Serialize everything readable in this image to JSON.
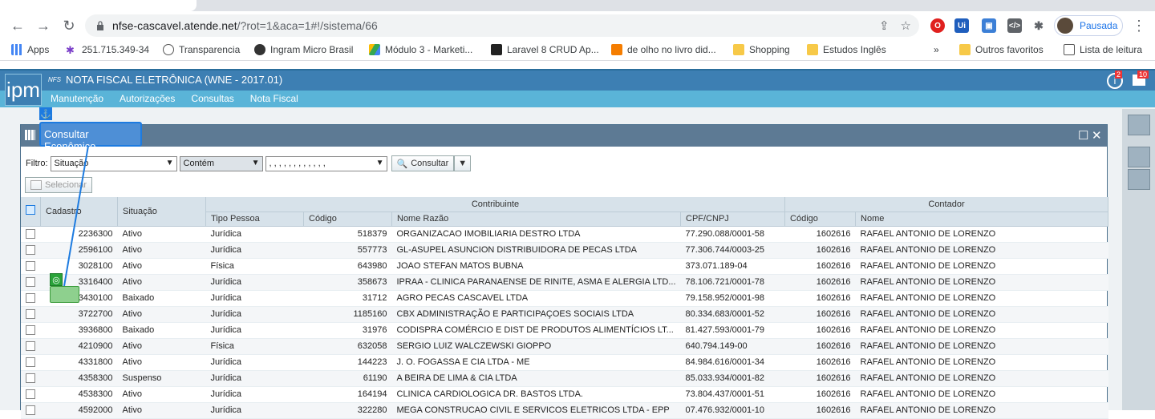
{
  "browser": {
    "url_host": "nfse-cascavel.atende.net",
    "url_path": "/?rot=1&aca=1#!/sistema/66",
    "profile_label": "Pausada"
  },
  "bookmarks": [
    "Apps",
    "251.715.349-34",
    "Transparencia",
    "Ingram Micro Brasil",
    "Módulo 3 - Marketi...",
    "Laravel 8 CRUD Ap...",
    "de olho no livro did...",
    "Shopping",
    "Estudos Inglês",
    "»",
    "Outros favoritos",
    "Lista de leitura"
  ],
  "app": {
    "title_prefix": "NFS",
    "title": "NOTA FISCAL ELETRÔNICA (WNE - 2017.01)",
    "logo": "ipm",
    "menu": [
      "Manutenção",
      "Autorizações",
      "Consultas",
      "Nota Fiscal"
    ],
    "badge_info": "2",
    "badge_print": "10"
  },
  "window": {
    "title": "Consultar Econômico",
    "filter_label": "Filtro:",
    "filter_field": "Situação",
    "filter_op": "Contém",
    "filter_value": ", , , , , , , , , , , ,",
    "consult_btn": "Consultar",
    "select_btn": "Selecionar"
  },
  "table": {
    "group_headers": {
      "contribuinte": "Contribuinte",
      "contador": "Contador"
    },
    "columns": [
      "Cadastro",
      "Situação",
      "Tipo Pessoa",
      "Código",
      "Nome Razão",
      "CPF/CNPJ",
      "Código",
      "Nome"
    ],
    "rows": [
      [
        "2236300",
        "Ativo",
        "Jurídica",
        "518379",
        "ORGANIZACAO IMOBILIARIA DESTRO LTDA",
        "77.290.088/0001-58",
        "1602616",
        "RAFAEL ANTONIO DE LORENZO"
      ],
      [
        "2596100",
        "Ativo",
        "Jurídica",
        "557773",
        "GL-ASUPEL ASUNCION DISTRIBUIDORA DE PECAS LTDA",
        "77.306.744/0003-25",
        "1602616",
        "RAFAEL ANTONIO DE LORENZO"
      ],
      [
        "3028100",
        "Ativo",
        "Física",
        "643980",
        "JOAO STEFAN MATOS BUBNA",
        "373.071.189-04",
        "1602616",
        "RAFAEL ANTONIO DE LORENZO"
      ],
      [
        "3316400",
        "Ativo",
        "Jurídica",
        "358673",
        "IPRAA - CLINICA PARANAENSE DE RINITE, ASMA E ALERGIA LTD...",
        "78.106.721/0001-78",
        "1602616",
        "RAFAEL ANTONIO DE LORENZO"
      ],
      [
        "3430100",
        "Baixado",
        "Jurídica",
        "31712",
        "AGRO PECAS CASCAVEL LTDA",
        "79.158.952/0001-98",
        "1602616",
        "RAFAEL ANTONIO DE LORENZO"
      ],
      [
        "3722700",
        "Ativo",
        "Jurídica",
        "1185160",
        "CBX ADMINISTRAÇÃO E PARTICIPAÇOES SOCIAIS LTDA",
        "80.334.683/0001-52",
        "1602616",
        "RAFAEL ANTONIO DE LORENZO"
      ],
      [
        "3936800",
        "Baixado",
        "Jurídica",
        "31976",
        "CODISPRA COMÉRCIO E DIST DE PRODUTOS ALIMENTÍCIOS LT...",
        "81.427.593/0001-79",
        "1602616",
        "RAFAEL ANTONIO DE LORENZO"
      ],
      [
        "4210900",
        "Ativo",
        "Física",
        "632058",
        "SERGIO LUIZ WALCZEWSKI GIOPPO",
        "640.794.149-00",
        "1602616",
        "RAFAEL ANTONIO DE LORENZO"
      ],
      [
        "4331800",
        "Ativo",
        "Jurídica",
        "144223",
        "J. O. FOGASSA E CIA LTDA - ME",
        "84.984.616/0001-34",
        "1602616",
        "RAFAEL ANTONIO DE LORENZO"
      ],
      [
        "4358300",
        "Suspenso",
        "Jurídica",
        "61190",
        "A BEIRA DE LIMA & CIA LTDA",
        "85.033.934/0001-82",
        "1602616",
        "RAFAEL ANTONIO DE LORENZO"
      ],
      [
        "4538300",
        "Ativo",
        "Jurídica",
        "164194",
        "CLINICA CARDIOLOGICA DR. BASTOS LTDA.",
        "73.804.437/0001-51",
        "1602616",
        "RAFAEL ANTONIO DE LORENZO"
      ],
      [
        "4592000",
        "Ativo",
        "Jurídica",
        "322280",
        "MEGA CONSTRUCAO CIVIL E SERVICOS ELETRICOS LTDA - EPP",
        "07.476.932/0001-10",
        "1602616",
        "RAFAEL ANTONIO DE LORENZO"
      ]
    ]
  },
  "colors": {
    "header_dark": "#3d7fb3",
    "header_light": "#5ab4d8",
    "window_title": "#5d7a94",
    "highlight": "#1d7be0"
  }
}
